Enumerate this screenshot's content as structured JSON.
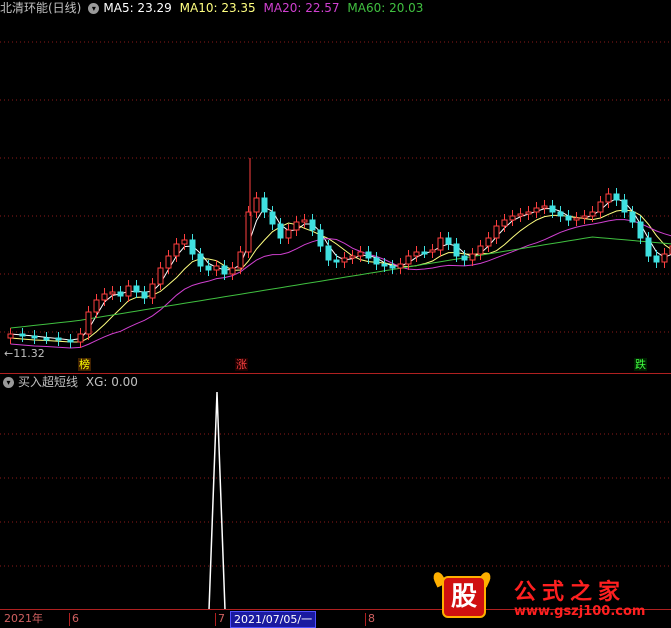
{
  "main_panel": {
    "stock_name": "北清环能(日线)",
    "indicators": [
      {
        "label": "MA5: 23.29",
        "color": "#ffffff"
      },
      {
        "label": "MA10: 23.35",
        "color": "#ffff80"
      },
      {
        "label": "MA20: 22.57",
        "color": "#d040d0"
      },
      {
        "label": "MA60: 20.03",
        "color": "#40c040"
      }
    ],
    "low_label": "←11.32",
    "markers": [
      {
        "text": "榜",
        "color": "#ffff00"
      },
      {
        "text": "涨",
        "color": "#ff4040"
      },
      {
        "text": "跌",
        "color": "#40ff40"
      }
    ]
  },
  "sub_panel": {
    "title": "买入超短线",
    "xg_label": "XG: 0.00"
  },
  "x_axis": {
    "labels": [
      "2021年",
      "6",
      "7",
      "8"
    ],
    "cursor_date": "2021/07/05/一"
  },
  "logo": {
    "icon_text": "股",
    "name": "公式之家",
    "url": "www.gszj100.com"
  },
  "colors": {
    "up": "#ff4040",
    "down": "#40e0e0",
    "ma5": "#ffffff",
    "ma10": "#ffff80",
    "ma20": "#d040d0",
    "ma60": "#40c040",
    "grid": "#8b1a1a"
  }
}
